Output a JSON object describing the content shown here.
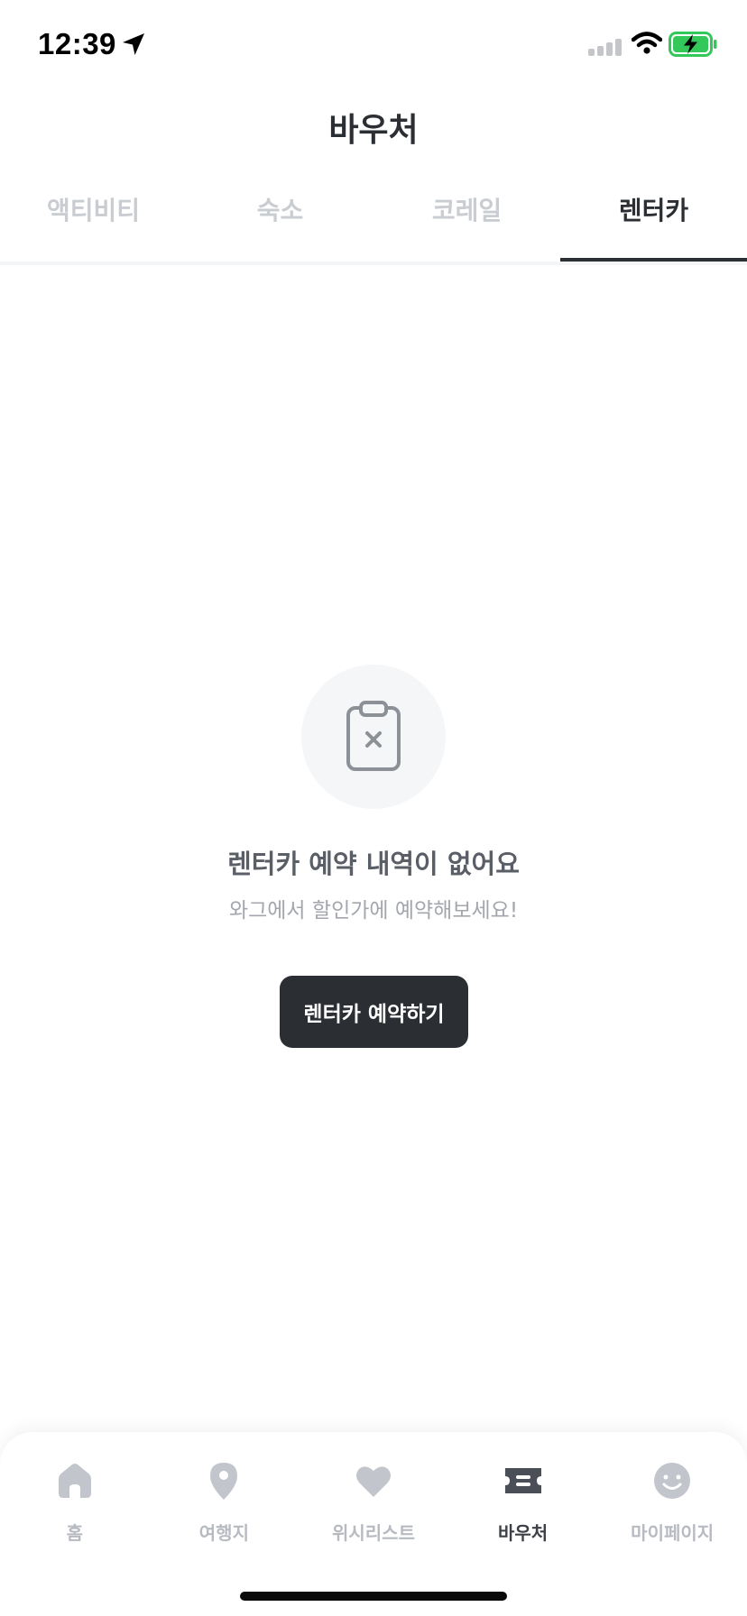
{
  "status_bar": {
    "time": "12:39",
    "icons": [
      "location-arrow-icon",
      "cellular-signal-icon",
      "wifi-icon",
      "battery-charging-icon"
    ],
    "battery_color": "#34c759"
  },
  "header": {
    "title": "바우처"
  },
  "tabs": [
    {
      "label": "액티비티",
      "active": false
    },
    {
      "label": "숙소",
      "active": false
    },
    {
      "label": "코레일",
      "active": false
    },
    {
      "label": "렌터카",
      "active": true
    }
  ],
  "empty_state": {
    "icon": "clipboard-x-icon",
    "title": "렌터카 예약 내역이 없어요",
    "subtitle": "와그에서 할인가에 예약해보세요!",
    "button_label": "렌터카 예약하기"
  },
  "bottom_nav": {
    "items": [
      {
        "label": "홈",
        "icon": "home-icon",
        "active": false
      },
      {
        "label": "여행지",
        "icon": "map-pin-icon",
        "active": false
      },
      {
        "label": "위시리스트",
        "icon": "heart-icon",
        "active": false
      },
      {
        "label": "바우처",
        "icon": "ticket-icon",
        "active": true
      },
      {
        "label": "마이페이지",
        "icon": "smiley-icon",
        "active": false
      }
    ]
  },
  "colors": {
    "primary_dark": "#2b2e33",
    "inactive_tab": "#c9ccd1",
    "inactive_nav": "#b7bbc1",
    "empty_circle_bg": "#f5f6f8"
  }
}
